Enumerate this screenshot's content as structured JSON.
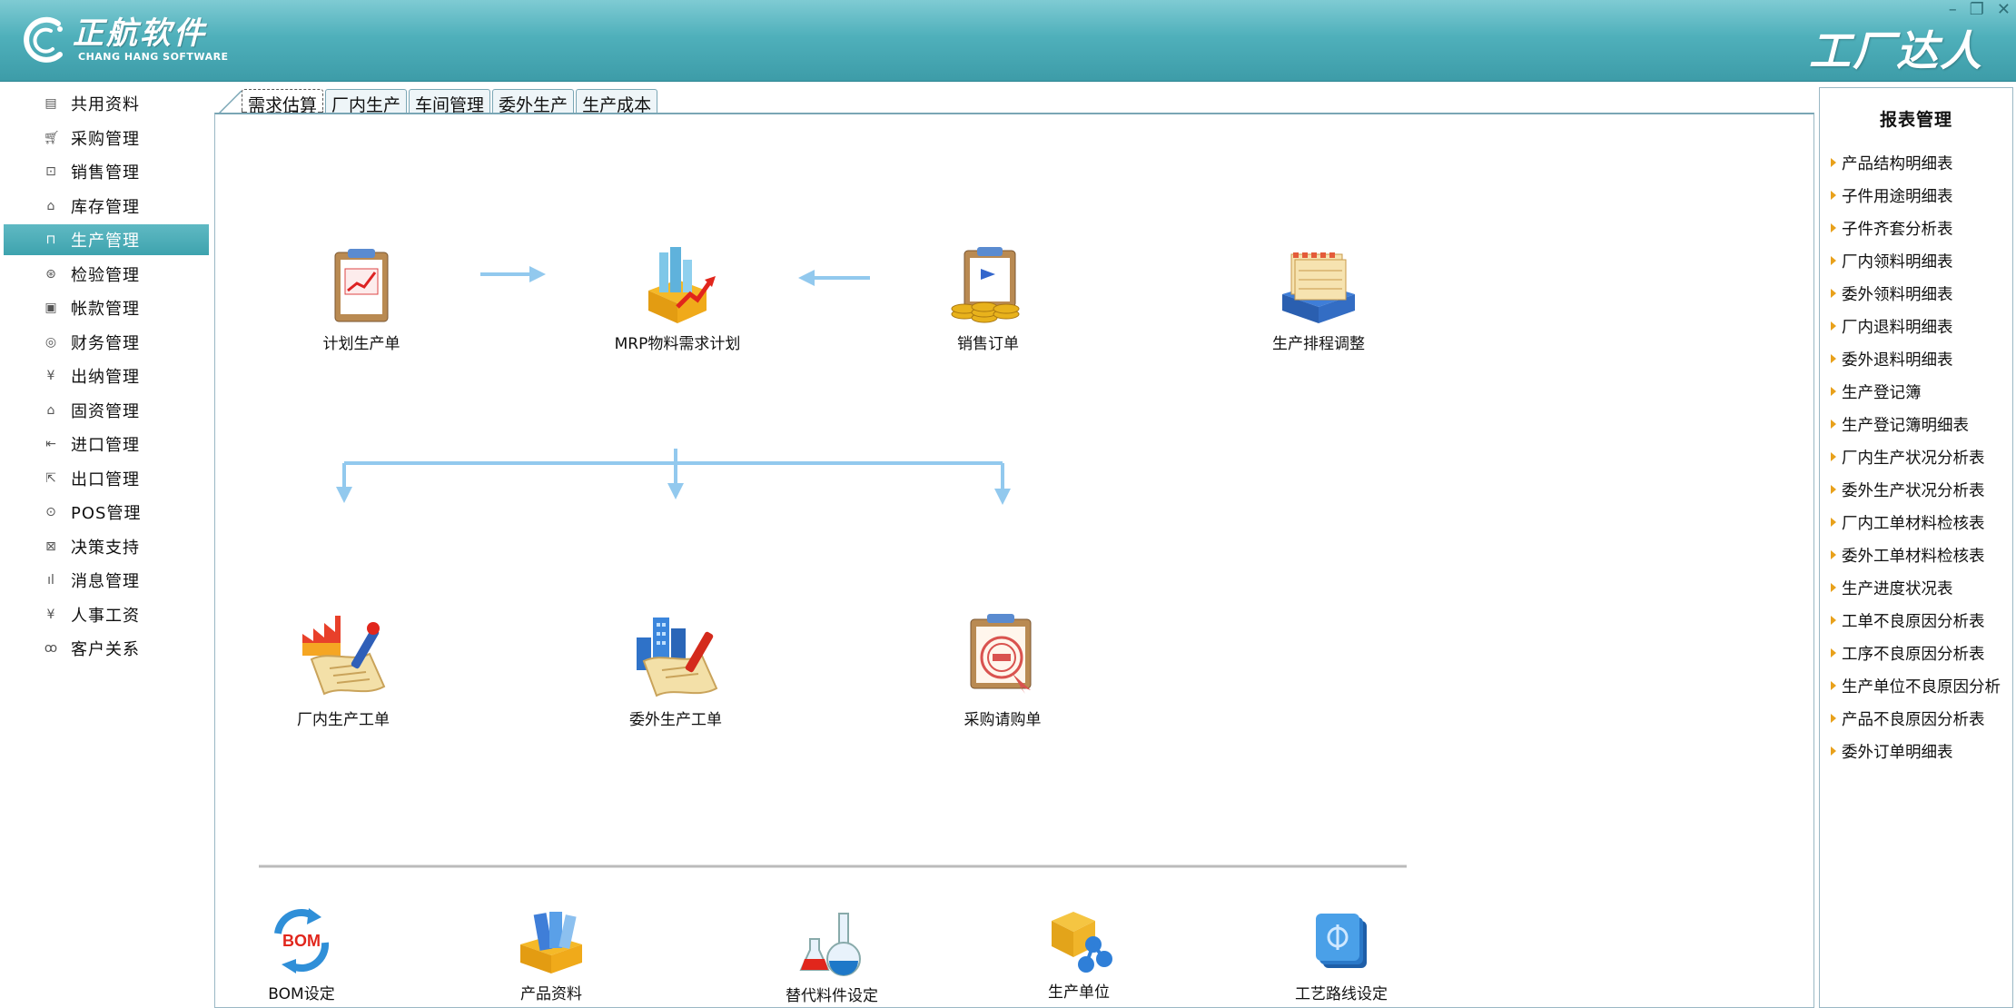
{
  "header": {
    "logo_cn": "正航软件",
    "logo_en": "CHANG HANG SOFTWARE",
    "brand_right": "工厂达人",
    "window_controls": [
      "minimize-icon",
      "restore-icon",
      "close-icon"
    ]
  },
  "sidebar": {
    "items": [
      {
        "label": "共用资料",
        "icon": "document-icon"
      },
      {
        "label": "采购管理",
        "icon": "cart-icon"
      },
      {
        "label": "销售管理",
        "icon": "sales-icon"
      },
      {
        "label": "库存管理",
        "icon": "warehouse-icon"
      },
      {
        "label": "生产管理",
        "icon": "factory-icon",
        "active": true
      },
      {
        "label": "检验管理",
        "icon": "inspect-icon"
      },
      {
        "label": "帐款管理",
        "icon": "ledger-icon"
      },
      {
        "label": "财务管理",
        "icon": "finance-icon"
      },
      {
        "label": "出纳管理",
        "icon": "yen-icon"
      },
      {
        "label": "固资管理",
        "icon": "house-icon"
      },
      {
        "label": "进口管理",
        "icon": "import-icon"
      },
      {
        "label": "出口管理",
        "icon": "export-icon"
      },
      {
        "label": "POS管理",
        "icon": "pos-icon"
      },
      {
        "label": "决策支持",
        "icon": "decision-icon"
      },
      {
        "label": "消息管理",
        "icon": "bar-chart-icon"
      },
      {
        "label": "人事工资",
        "icon": "payroll-icon"
      },
      {
        "label": "客户关系",
        "icon": "people-icon"
      }
    ]
  },
  "tabs": [
    {
      "label": "需求估算",
      "active": true
    },
    {
      "label": "厂内生产"
    },
    {
      "label": "车间管理"
    },
    {
      "label": "委外生产"
    },
    {
      "label": "生产成本"
    }
  ],
  "flow": {
    "nodes": [
      {
        "label": "计划生产单",
        "icon": "plan-chart-icon"
      },
      {
        "label": "MRP物料需求计划",
        "icon": "mrp-icon"
      },
      {
        "label": "销售订单",
        "icon": "sales-order-icon"
      },
      {
        "label": "生产排程调整",
        "icon": "schedule-icon"
      },
      {
        "label": "厂内生产工单",
        "icon": "factory-order-icon"
      },
      {
        "label": "委外生产工单",
        "icon": "outsource-order-icon"
      },
      {
        "label": "采购请购单",
        "icon": "purchase-request-icon"
      }
    ],
    "settings": [
      {
        "label": "BOM设定",
        "icon": "bom-icon",
        "badge": "BOM"
      },
      {
        "label": "产品资料",
        "icon": "product-box-icon"
      },
      {
        "label": "替代料件设定",
        "icon": "flask-icon"
      },
      {
        "label": "生产单位",
        "icon": "unit-cube-icon"
      },
      {
        "label": "工艺路线设定",
        "icon": "routing-icon"
      }
    ]
  },
  "reports": {
    "title": "报表管理",
    "items": [
      "产品结构明细表",
      "子件用途明细表",
      "子件齐套分析表",
      "厂内领料明细表",
      "委外领料明细表",
      "厂内退料明细表",
      "委外退料明细表",
      "生产登记簿",
      "生产登记簿明细表",
      "厂内生产状况分析表",
      "委外生产状况分析表",
      "厂内工单材料检核表",
      "委外工单材料检核表",
      "生产进度状况表",
      "工单不良原因分析表",
      "工序不良原因分析表",
      "生产单位不良原因分析",
      "产品不良原因分析表",
      "委外订单明细表"
    ]
  },
  "colors": {
    "header": "#4fb0bb",
    "active_item": "#3ea3ae",
    "flow_arrow": "#92c9ee",
    "report_bullet": "#e8a11b"
  }
}
